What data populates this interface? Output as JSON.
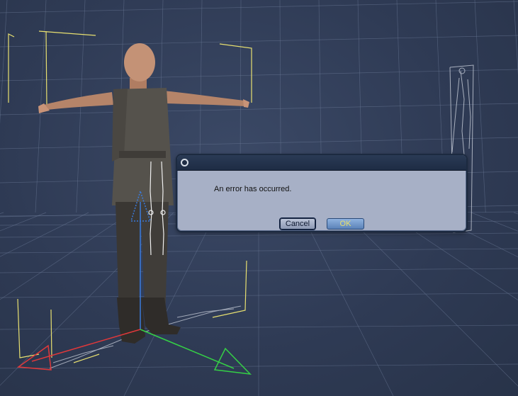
{
  "viewport": {
    "grid_color": "#6b7a98",
    "background_color": "#2f3b55"
  },
  "dialog": {
    "close_icon": "close-dot-icon",
    "message": "An error has occurred.",
    "cancel_label": "Cancel",
    "ok_label": "OK",
    "ok_text_color": "#e8e06a"
  }
}
